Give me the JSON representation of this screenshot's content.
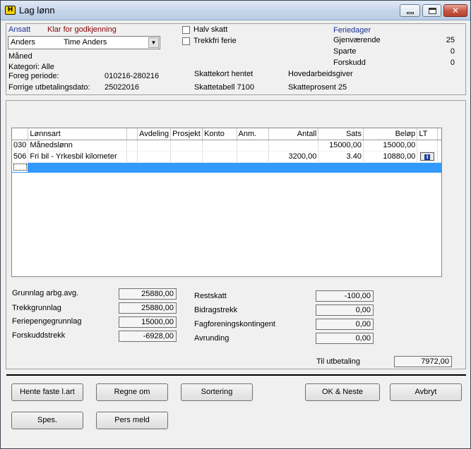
{
  "window": {
    "title": "Lag lønn",
    "app_icon_letter": "H"
  },
  "employee": {
    "label": "Ansatt",
    "status": "Klar for godkjenning",
    "selected_name": "Anders",
    "selected_fullname": "Time Anders",
    "period_type": "Måned",
    "category": "Kategori: Alle",
    "prev_period_label": "Foreg periode:",
    "prev_period_value": "010216-280216",
    "prev_payout_label": "Forrige utbetalingsdato:",
    "prev_payout_value": "25022016"
  },
  "options": {
    "half_tax_label": "Halv skatt",
    "half_tax_checked": false,
    "trekkfri_label": "Trekkfri ferie",
    "trekkfri_checked": false
  },
  "tax": {
    "card_fetched": "Skattekort hentet",
    "table": "Skattetabell 7100",
    "employer": "Hovedarbeidsgiver",
    "percent": "Skatteprosent 25"
  },
  "holiday": {
    "title": "Feriedager",
    "rows": [
      {
        "label": "Gjenværende",
        "value": "25"
      },
      {
        "label": "Sparte",
        "value": "0"
      },
      {
        "label": "Forskudd",
        "value": "0"
      }
    ]
  },
  "grid": {
    "headers": [
      "",
      "Lønnsart",
      "",
      "Avdeling",
      "Prosjekt",
      "Konto",
      "Anm.",
      "Antall",
      "Sats",
      "Beløp",
      "LT"
    ],
    "rows": [
      {
        "code": "030",
        "name": "Månedslønn",
        "antall": "",
        "sats": "15000,00",
        "belop": "15000,00",
        "lt": false
      },
      {
        "code": "506",
        "name": "Fri bil - Yrkesbil  kilometer",
        "antall": "3200,00",
        "sats": "3.40",
        "belop": "10880,00",
        "lt": true
      }
    ],
    "lt_icon_letter": "i"
  },
  "summary_left": [
    {
      "label": "Grunnlag arbg.avg.",
      "value": "25880,00"
    },
    {
      "label": "Trekkgrunnlag",
      "value": "25880,00"
    },
    {
      "label": "Feriepengegrunnlag",
      "value": "15000,00"
    },
    {
      "label": "Forskuddstrekk",
      "value": "-6928,00"
    }
  ],
  "summary_right": [
    {
      "label": "Restskatt",
      "value": "-100,00"
    },
    {
      "label": "Bidragstrekk",
      "value": "0,00"
    },
    {
      "label": "Fagforeningskontingent",
      "value": "0,00"
    },
    {
      "label": "Avrunding",
      "value": "0,00"
    }
  ],
  "payout": {
    "label": "Til utbetaling",
    "value": "7972,00"
  },
  "buttons": {
    "fetch": "Hente faste l.art",
    "recalc": "Regne om",
    "sort": "Sortering",
    "ok_next": "OK & Neste",
    "cancel": "Avbryt",
    "spec": "Spes.",
    "pers": "Pers meld"
  }
}
